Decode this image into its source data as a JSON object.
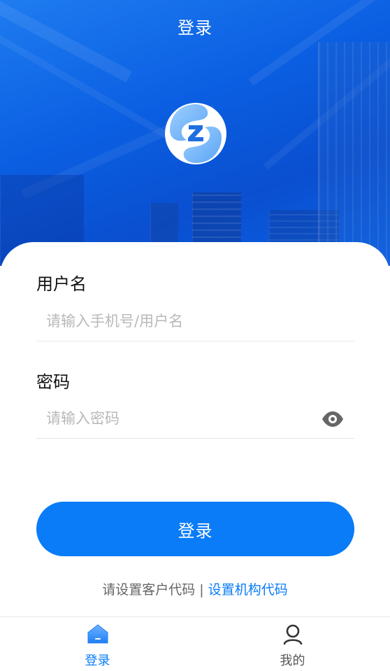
{
  "header": {
    "title": "登录"
  },
  "logo": {
    "icon": "brand-logo-icon"
  },
  "form": {
    "username": {
      "label": "用户名",
      "value": "",
      "placeholder": "请输入手机号/用户名"
    },
    "password": {
      "label": "密码",
      "value": "",
      "placeholder": "请输入密码",
      "toggle_icon": "eye-icon"
    },
    "submit_label": "登录"
  },
  "customer_code": {
    "text": "请设置客户代码",
    "separator": " | ",
    "link": "设置机构代码"
  },
  "tabbar": {
    "tabs": [
      {
        "label": "登录",
        "icon": "home-icon",
        "active": true
      },
      {
        "label": "我的",
        "icon": "person-icon",
        "active": false
      }
    ]
  },
  "colors": {
    "accent": "#0a7cf7",
    "hero": "#0b5fe2"
  }
}
